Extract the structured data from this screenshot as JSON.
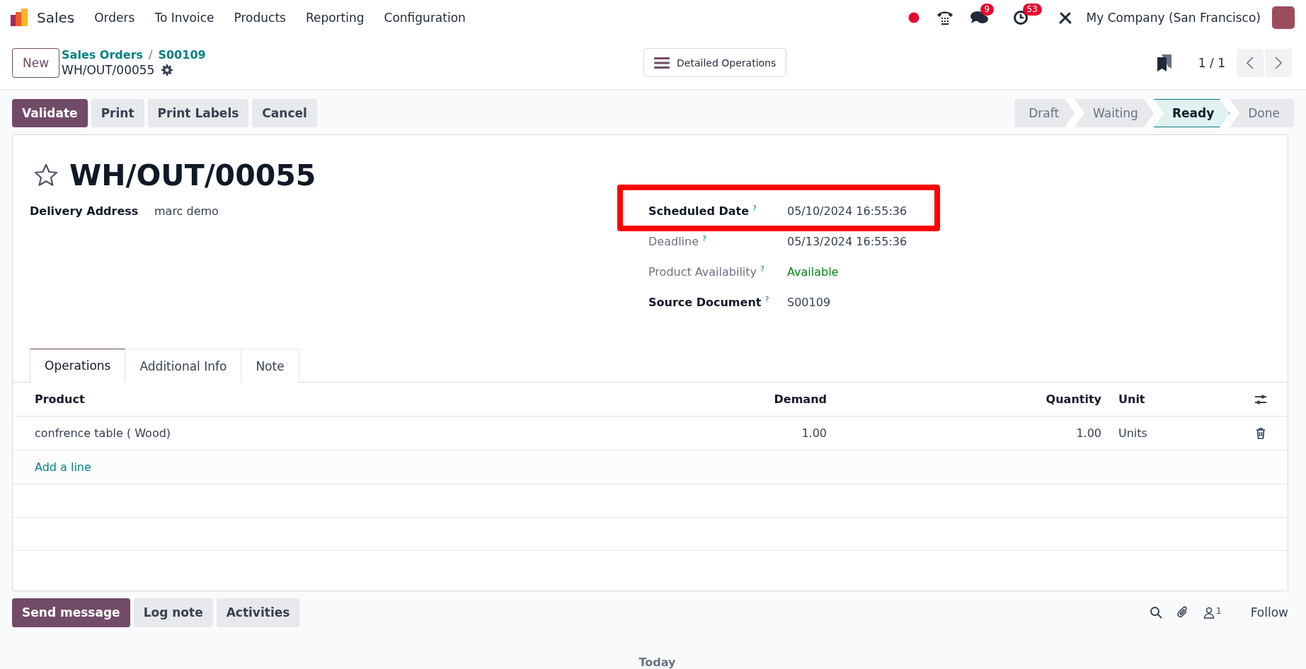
{
  "navbar": {
    "app": "Sales",
    "menus": [
      "Orders",
      "To Invoice",
      "Products",
      "Reporting",
      "Configuration"
    ],
    "messages_badge": "9",
    "activities_badge": "53",
    "company": "My Company (San Francisco)"
  },
  "control_panel": {
    "new_button": "New",
    "breadcrumbs": [
      "Sales Orders",
      "S00109"
    ],
    "separator": "/",
    "record": "WH/OUT/00055",
    "view_button": "Detailed Operations",
    "pager": "1 / 1"
  },
  "actions": [
    {
      "label": "Validate",
      "primary": true
    },
    {
      "label": "Print",
      "primary": false
    },
    {
      "label": "Print Labels",
      "primary": false
    },
    {
      "label": "Cancel",
      "primary": false
    }
  ],
  "stages": [
    {
      "label": "Draft",
      "selected": false
    },
    {
      "label": "Waiting",
      "selected": false
    },
    {
      "label": "Ready",
      "selected": true
    },
    {
      "label": "Done",
      "selected": false
    }
  ],
  "record": {
    "starred": false,
    "title": "WH/OUT/00055",
    "left_fields": [
      {
        "label": "Delivery Address",
        "value": "marc demo"
      }
    ],
    "right_fields": [
      {
        "label": "Scheduled Date",
        "help": "?",
        "value": "05/10/2024 16:55:36",
        "required": true,
        "kind": "text",
        "highlighted": true
      },
      {
        "label": "Deadline",
        "help": "?",
        "value": "05/13/2024 16:55:36",
        "required": false,
        "kind": "text",
        "highlighted": false
      },
      {
        "label": "Product Availability",
        "help": "?",
        "value": "Available",
        "required": false,
        "kind": "status",
        "highlighted": false
      },
      {
        "label": "Source Document",
        "help": "?",
        "value": "S00109",
        "required": true,
        "kind": "text",
        "highlighted": false
      }
    ]
  },
  "tabs": [
    {
      "label": "Operations",
      "selected": true
    },
    {
      "label": "Additional Info",
      "selected": false
    },
    {
      "label": "Note",
      "selected": false
    }
  ],
  "table": {
    "columns": [
      "Product",
      "Demand",
      "Quantity",
      "Unit"
    ],
    "rows": [
      {
        "product": "confrence table ( Wood)",
        "demand": "1.00",
        "quantity": "1.00",
        "unit": "Units"
      }
    ],
    "add_line": "Add a line"
  },
  "chatter": {
    "buttons": [
      {
        "label": "Send message",
        "primary": true
      },
      {
        "label": "Log note",
        "primary": false
      },
      {
        "label": "Activities",
        "primary": false
      }
    ],
    "followers_count": "1",
    "follow": "Follow",
    "today": "Today"
  }
}
